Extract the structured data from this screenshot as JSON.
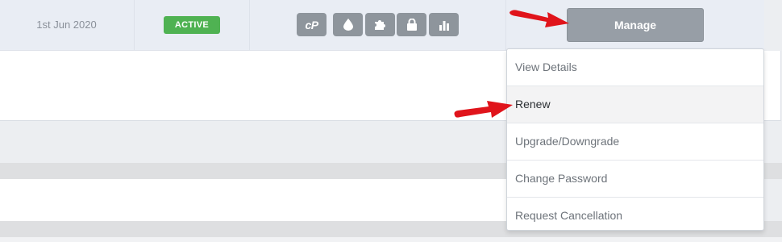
{
  "service_row": {
    "date": "1st Jun 2020",
    "status": "ACTIVE",
    "icons": [
      {
        "name": "cpanel-icon",
        "label": "cP"
      },
      {
        "name": "droplet-icon"
      },
      {
        "name": "puzzle-icon"
      },
      {
        "name": "lock-icon"
      },
      {
        "name": "bar-chart-icon"
      }
    ],
    "manage_label": "Manage"
  },
  "dropdown": {
    "items": [
      {
        "label": "View Details"
      },
      {
        "label": "Renew",
        "highlighted": true
      },
      {
        "label": "Upgrade/Downgrade"
      },
      {
        "label": "Change Password"
      },
      {
        "label": "Request Cancellation"
      }
    ]
  },
  "colors": {
    "status_green": "#4fb252",
    "icon_grey": "#8e959c",
    "manage_grey": "#979ea6",
    "arrow_red": "#e0141b",
    "row_bg": "#e9edf4"
  }
}
